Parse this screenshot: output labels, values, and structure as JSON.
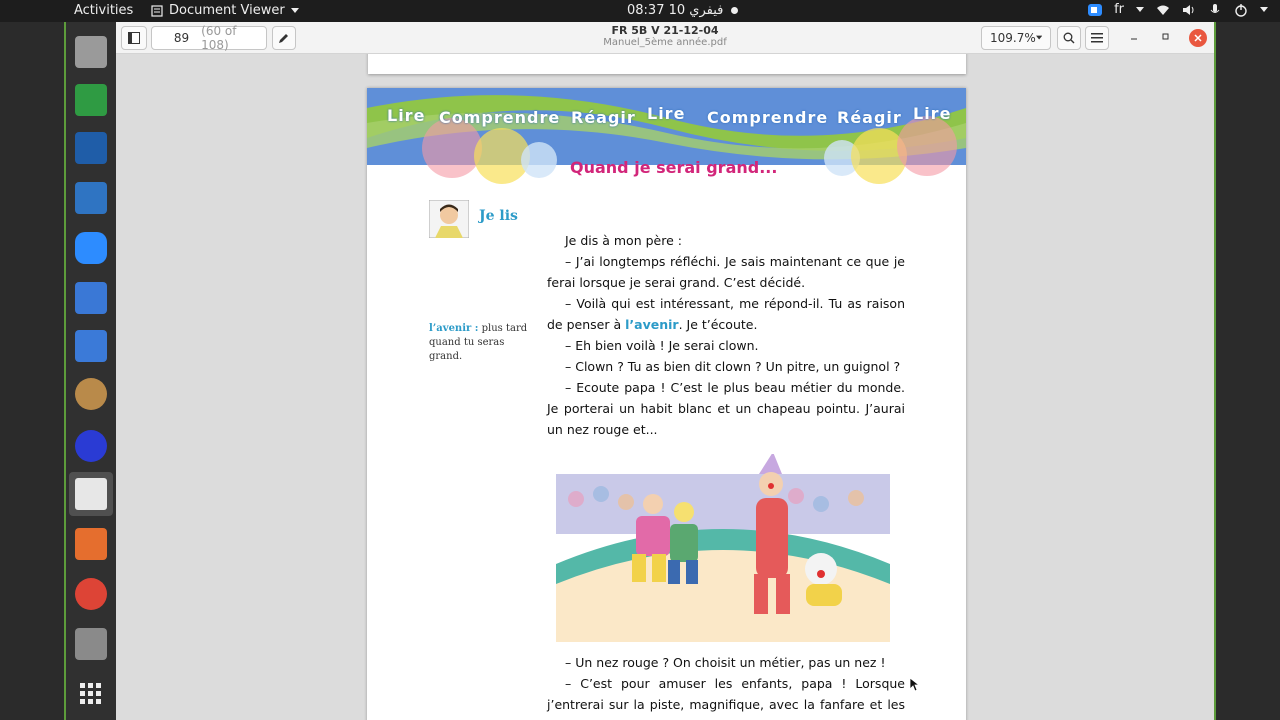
{
  "topbar": {
    "activities": "Activities",
    "app_name": "Document Viewer",
    "clock": "08:37  فيفري 10",
    "lang": "fr"
  },
  "header": {
    "page_number": "89",
    "page_total": "(60 of 108)",
    "title": "FR 5B V 21-12-04",
    "subtitle": "Manuel_5ème année.pdf",
    "zoom": "109.7%"
  },
  "banner": {
    "words": [
      "Lire",
      "Comprendre",
      "Réagir",
      "Lire",
      "Comprendre",
      "Réagir",
      "Lire"
    ]
  },
  "page": {
    "story_title": "Quand je serai grand...",
    "section_label": "Je lis",
    "gloss_term": "l’avenir :",
    "gloss_def": "plus tard quand tu seras grand.",
    "paragraphs": [
      "Je dis à mon père :",
      "– J’ai longtemps réfléchi. Je sais maintenant ce que je ferai lorsque je serai grand. C’est décidé.",
      "– Voilà qui est intéressant, me répond-il. Tu as raison de penser à",
      "l’avenir",
      ". Je t’écoute.",
      "– Eh bien voilà ! Je serai clown.",
      "– Clown ? Tu as bien dit clown ? Un pitre, un guignol ?",
      "– Ecoute papa ! C’est le plus beau métier du monde. Je porterai un habit blanc et un chapeau pointu. J’aurai un nez rouge et..."
    ],
    "paragraphs_after": [
      "– Un nez rouge ? On choisit un métier, pas un nez !",
      "– C’est pour amuser les enfants, papa ! Lorsque j’entrerai sur la piste, magnifique, avec la fanfare et les projecteurs,"
    ]
  },
  "colors": {
    "accent_green": "#5d9c3b",
    "title_pink": "#d2267a",
    "label_blue": "#2c9bc8",
    "close_red": "#e9573f"
  },
  "icons": {
    "dock": [
      "files-icon",
      "spreadsheet-icon",
      "virtualbox-icon",
      "document-icon",
      "zoom-icon",
      "screenshot-icon",
      "tasks-icon",
      "paint-icon",
      "app-icon",
      "document-viewer-icon",
      "presentation-icon",
      "chrome-icon",
      "usb-icon",
      "apps-grid-icon"
    ]
  }
}
